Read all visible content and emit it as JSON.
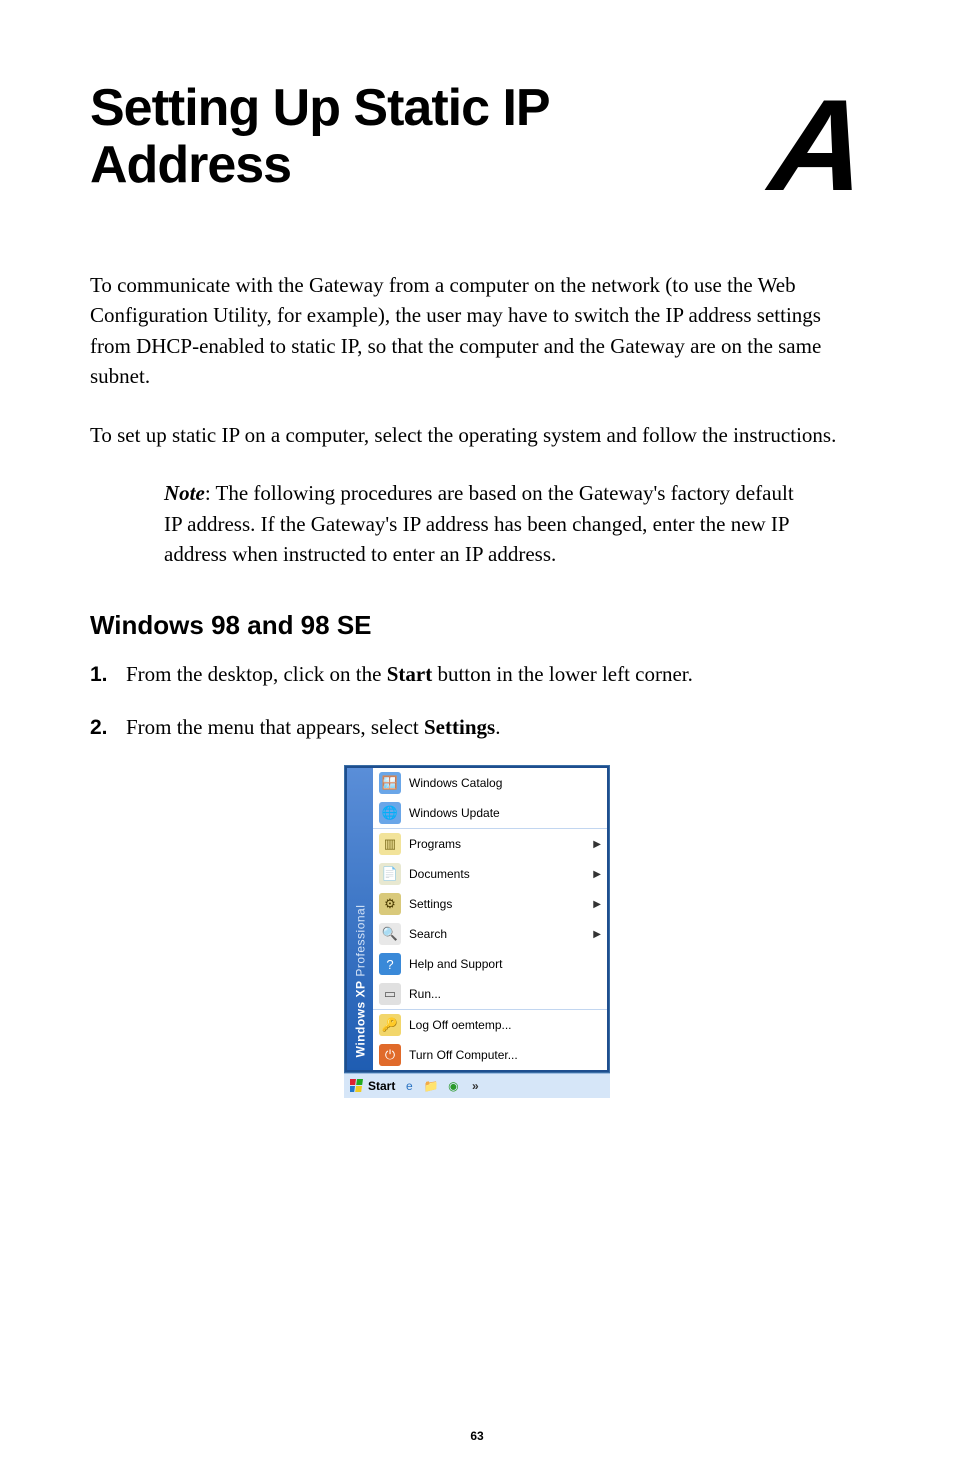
{
  "title": "Setting Up Static IP Address",
  "chapter_letter": "A",
  "paragraphs": {
    "p1": "To communicate with the Gateway from a computer on the network (to use the Web Configuration Utility, for example), the user may have to switch the IP address settings from DHCP-enabled to static IP, so that the computer and the Gateway are on the same subnet.",
    "p2": "To set up static IP on a computer, select the operating system and follow the instructions."
  },
  "note": {
    "label": "Note",
    "text": ": The following procedures are based on the Gateway's factory default IP address. If the Gateway's IP address has been changed, enter the new IP address when instructed to enter an IP address."
  },
  "section_heading": "Windows 98 and 98 SE",
  "steps": [
    {
      "num": "1.",
      "pre": "From the desktop, click on the ",
      "bold": "Start",
      "post": " button in the lower left corner."
    },
    {
      "num": "2.",
      "pre": "From the menu that appears, select ",
      "bold": "Settings",
      "post": "."
    }
  ],
  "start_menu": {
    "sidebar": "Windows XP",
    "sidebar_sub": " Professional",
    "top": [
      "Windows Catalog",
      "Windows Update"
    ],
    "main": [
      {
        "label": "Programs",
        "arrow": true,
        "icon": "programs"
      },
      {
        "label": "Documents",
        "arrow": true,
        "icon": "documents"
      },
      {
        "label": "Settings",
        "arrow": true,
        "icon": "settings"
      },
      {
        "label": "Search",
        "arrow": true,
        "icon": "search"
      },
      {
        "label": "Help and Support",
        "arrow": false,
        "icon": "help"
      },
      {
        "label": "Run...",
        "arrow": false,
        "icon": "run"
      }
    ],
    "bottom": [
      {
        "label": "Log Off oemtemp...",
        "icon": "logoff"
      },
      {
        "label": "Turn Off Computer...",
        "icon": "turnoff"
      }
    ],
    "taskbar": {
      "start": "Start",
      "chevrons": "»"
    }
  },
  "page_number": "63"
}
